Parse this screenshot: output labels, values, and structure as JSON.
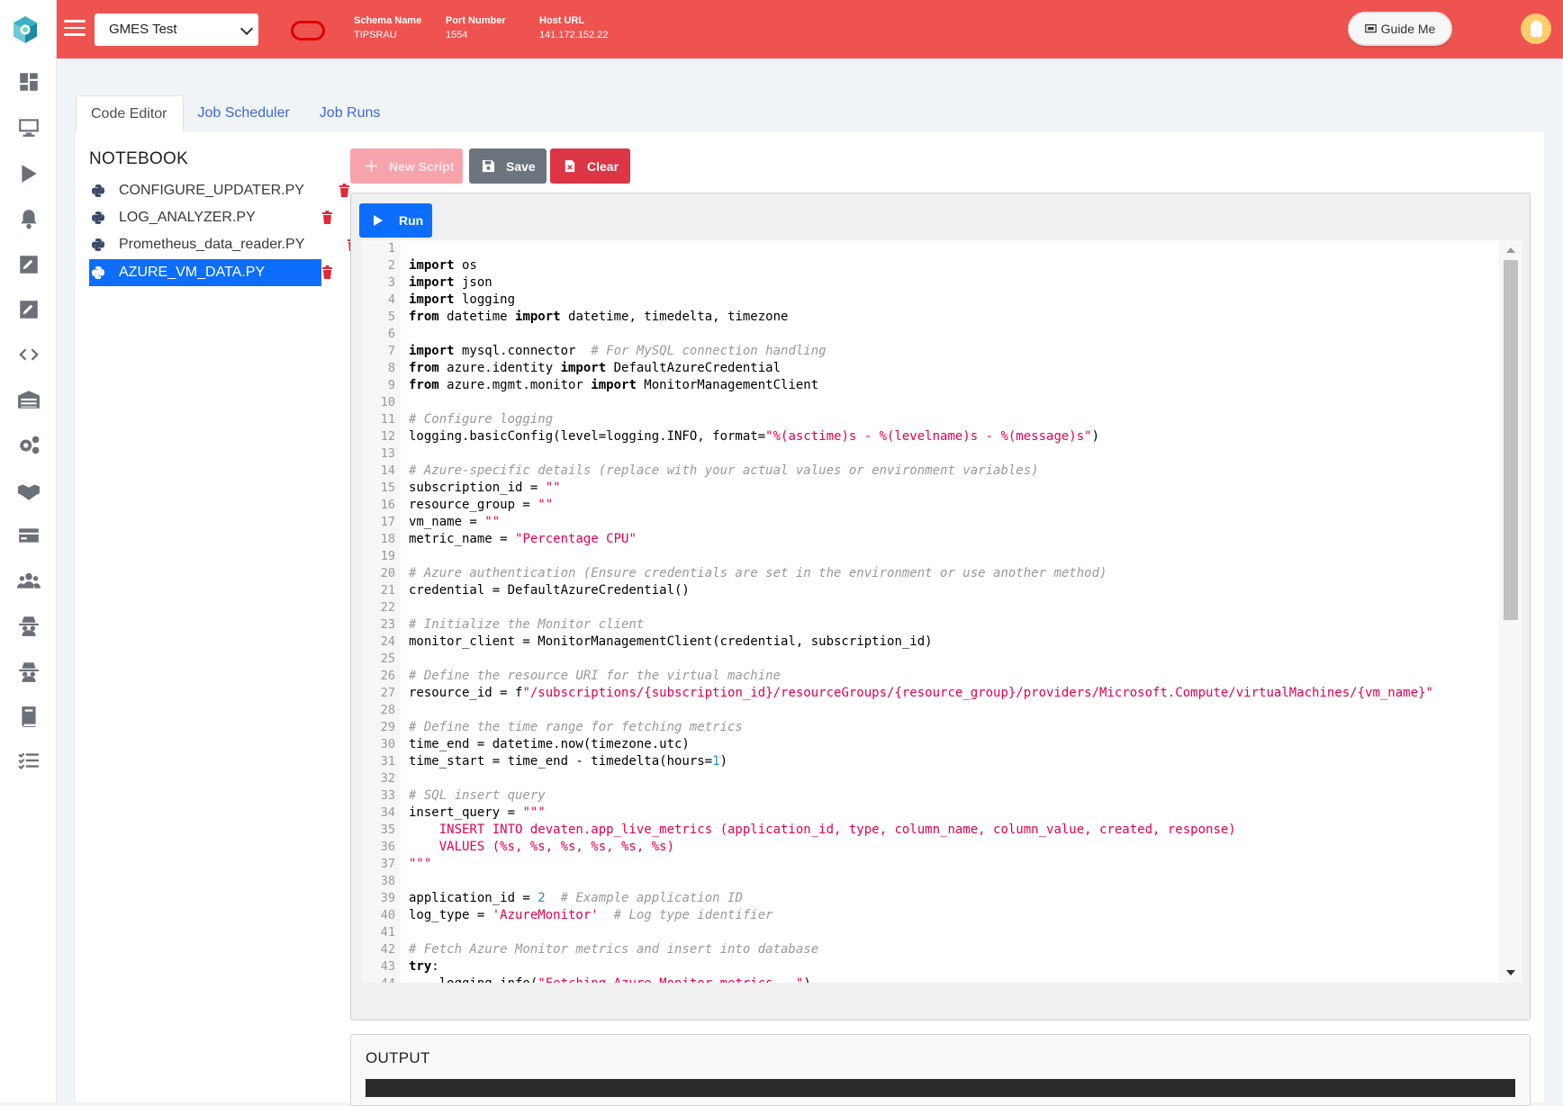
{
  "header": {
    "db_selected": "GMES Test",
    "info": [
      {
        "key": "Schema Name",
        "value": "TIPSRAU"
      },
      {
        "key": "Port Number",
        "value": "1554"
      },
      {
        "key": "Host URL",
        "value": "141.172.152.22"
      }
    ],
    "guide_label": "Guide Me"
  },
  "tabs": [
    "Code Editor",
    "Job Scheduler",
    "Job Runs"
  ],
  "notebook": {
    "title": "NOTEBOOK",
    "files": [
      "CONFIGURE_UPDATER.PY",
      "LOG_ANALYZER.PY",
      "Prometheus_data_reader.PY",
      "AZURE_VM_DATA.PY"
    ],
    "selected": "AZURE_VM_DATA.PY"
  },
  "toolbar": {
    "new_script": "New Script",
    "save": "Save",
    "clear": "Clear",
    "run": "Run"
  },
  "output": {
    "title": "OUTPUT"
  },
  "colors": {
    "topbar": "#ef5350",
    "primary": "#0d6efd",
    "danger": "#dc3545",
    "secondary": "#6c757d"
  },
  "sidebar_icons": [
    "dashboard-icon",
    "monitor-icon",
    "play-icon",
    "bell-icon",
    "edit-icon",
    "edit-alt-icon",
    "code-icon",
    "warehouse-icon",
    "settings-icon",
    "handshake-icon",
    "card-icon",
    "users-icon",
    "spy-icon",
    "spy-alt-icon",
    "book-icon",
    "task-list-icon"
  ],
  "code_lines": [
    "",
    "import os",
    "import json",
    "import logging",
    "from datetime import datetime, timedelta, timezone",
    "",
    "import mysql.connector  # For MySQL connection handling",
    "from azure.identity import DefaultAzureCredential",
    "from azure.mgmt.monitor import MonitorManagementClient",
    "",
    "# Configure logging",
    "logging.basicConfig(level=logging.INFO, format=\"%(asctime)s - %(levelname)s - %(message)s\")",
    "",
    "# Azure-specific details (replace with your actual values or environment variables)",
    "subscription_id = \"\"",
    "resource_group = \"\"",
    "vm_name = \"\"",
    "metric_name = \"Percentage CPU\"",
    "",
    "# Azure authentication (Ensure credentials are set in the environment or use another method)",
    "credential = DefaultAzureCredential()",
    "",
    "# Initialize the Monitor client",
    "monitor_client = MonitorManagementClient(credential, subscription_id)",
    "",
    "# Define the resource URI for the virtual machine",
    "resource_id = f\"/subscriptions/{subscription_id}/resourceGroups/{resource_group}/providers/Microsoft.Compute/virtualMachines/{vm_name}\"",
    "",
    "# Define the time range for fetching metrics",
    "time_end = datetime.now(timezone.utc)",
    "time_start = time_end - timedelta(hours=1)",
    "",
    "# SQL insert query",
    "insert_query = \"\"\"",
    "    INSERT INTO devaten.app_live_metrics (application_id, type, column_name, column_value, created, response)",
    "    VALUES (%s, %s, %s, %s, %s, %s)",
    "\"\"\"",
    "",
    "application_id = 2  # Example application ID",
    "log_type = 'AzureMonitor'  # Log type identifier",
    "",
    "# Fetch Azure Monitor metrics and insert into database",
    "try:",
    "    logging.info(\"Fetching Azure Monitor metrics...\")"
  ]
}
